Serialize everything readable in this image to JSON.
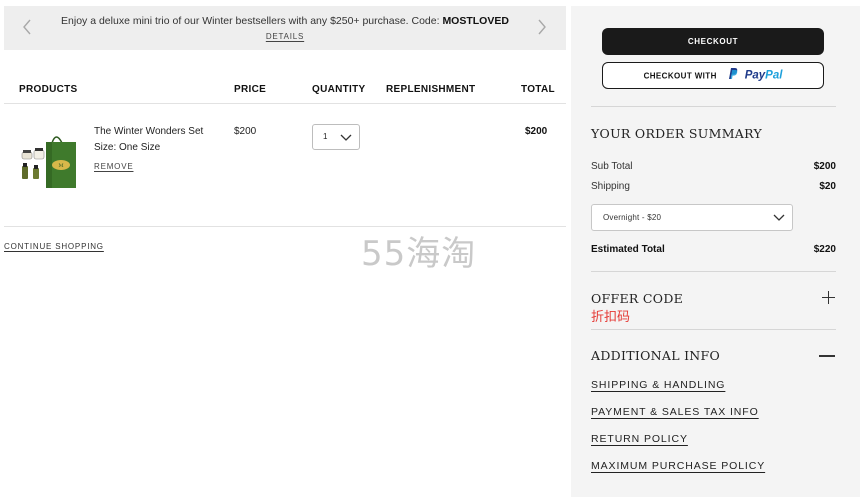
{
  "promo": {
    "message": "Enjoy a deluxe mini trio of our Winter bestsellers with any $250+ purchase. Code: ",
    "code": "MOSTLOVED",
    "details_label": "DETAILS",
    "prev_icon": "chevron-left-icon",
    "next_icon": "chevron-right-icon"
  },
  "table": {
    "headers": {
      "products": "PRODUCTS",
      "price": "PRICE",
      "quantity": "QUANTITY",
      "replenishment": "REPLENISHMENT",
      "total": "TOTAL"
    }
  },
  "cart_item": {
    "name": "The Winter Wonders Set",
    "size": "Size: One Size",
    "remove_label": "REMOVE",
    "price": "$200",
    "quantity": "1",
    "total": "$200",
    "bag_color": "#3f7a2c"
  },
  "continue_label": "CONTINUE SHOPPING",
  "watermark": "55海淘",
  "summary": {
    "checkout_label": "CHECKOUT",
    "paypal_prefix": "CHECKOUT WITH",
    "paypal_pay": "Pay",
    "paypal_pal": "Pal",
    "title": "YOUR ORDER SUMMARY",
    "subtotal_label": "Sub Total",
    "subtotal_value": "$200",
    "shipping_label": "Shipping",
    "shipping_value": "$20",
    "shipping_option": "Overnight - $20",
    "estimated_label": "Estimated Total",
    "estimated_value": "$220"
  },
  "offer": {
    "title": "OFFER CODE",
    "subtitle": "折扣码",
    "expand_icon": "plus-icon"
  },
  "additional": {
    "title": "ADDITIONAL INFO",
    "collapse_icon": "minus-icon",
    "links": [
      "SHIPPING & HANDLING",
      "PAYMENT & SALES TAX INFO",
      "RETURN POLICY",
      "MAXIMUM PURCHASE POLICY"
    ]
  },
  "colors": {
    "panel_bg": "#f4f4f4",
    "promo_bg": "#eeeeee",
    "checkout_bg": "#1a1a1a",
    "paypal_dark": "#1e3a8a",
    "paypal_light": "#1ea0db",
    "offer_subtitle": "#e53935"
  }
}
